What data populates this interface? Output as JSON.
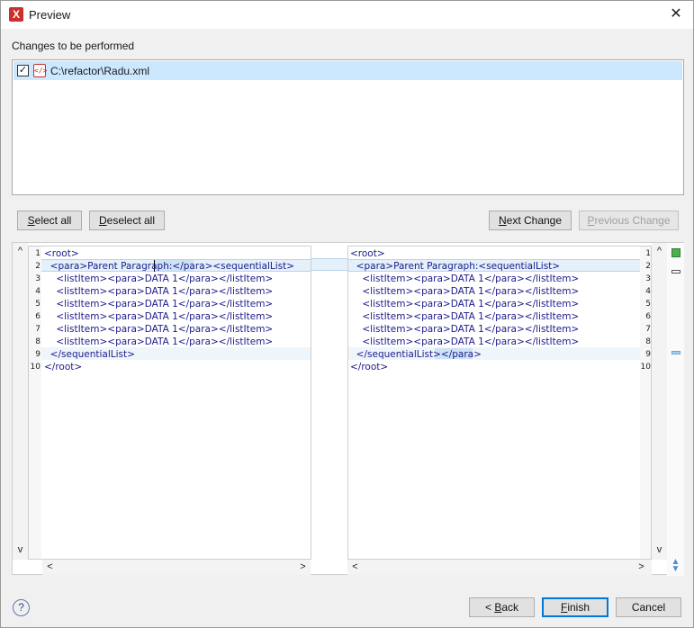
{
  "window": {
    "title": "Preview",
    "close_symbol": "✕",
    "app_icon_glyph": "X"
  },
  "changes_label": "Changes to be performed",
  "files": [
    {
      "path": "C:\\refactor\\Radu.xml",
      "checked": true,
      "check_glyph": "✓"
    }
  ],
  "buttons": {
    "select_all": {
      "key": "S",
      "rest": "elect all"
    },
    "deselect_all": {
      "key": "D",
      "rest": "eselect all"
    },
    "next_change": {
      "key": "N",
      "rest": "ext Change"
    },
    "previous_change": {
      "key": "P",
      "rest": "revious Change"
    },
    "back": {
      "pre": "< ",
      "key": "B",
      "rest": "ack"
    },
    "finish": {
      "key": "F",
      "rest": "inish"
    },
    "cancel": "Cancel"
  },
  "left_pane": {
    "line_numbers": [
      "1",
      "2",
      "3",
      "4",
      "5",
      "6",
      "7",
      "8",
      "9",
      "10"
    ],
    "lines": [
      "<root>",
      "  <para>Parent Paragraph:</para><sequentialList>",
      "    <listItem><para>DATA 1</para></listItem>",
      "    <listItem><para>DATA 1</para></listItem>",
      "    <listItem><para>DATA 1</para></listItem>",
      "    <listItem><para>DATA 1</para></listItem>",
      "    <listItem><para>DATA 1</para></listItem>",
      "    <listItem><para>DATA 1</para></listItem>",
      "  </sequentialList>",
      "</root>"
    ]
  },
  "right_pane": {
    "line_numbers": [
      "1",
      "2",
      "3",
      "4",
      "5",
      "6",
      "7",
      "8",
      "9",
      "10"
    ],
    "lines": [
      "<root>",
      "  <para>Parent Paragraph:<sequentialList>",
      "    <listItem><para>DATA 1</para></listItem>",
      "    <listItem><para>DATA 1</para></listItem>",
      "    <listItem><para>DATA 1</para></listItem>",
      "    <listItem><para>DATA 1</para></listItem>",
      "    <listItem><para>DATA 1</para></listItem>",
      "    <listItem><para>DATA 1</para></listItem>",
      "  </sequentialList></para>",
      "</root>"
    ]
  },
  "scroll_glyphs": {
    "up": "^",
    "down": "v",
    "left": "<",
    "right": ">"
  },
  "help_glyph": "?",
  "colors": {
    "selection": "#cce8ff",
    "change_bg": "#e4f0fa",
    "overview_marker": "#4caf50",
    "default_button_border": "#0078d7"
  }
}
